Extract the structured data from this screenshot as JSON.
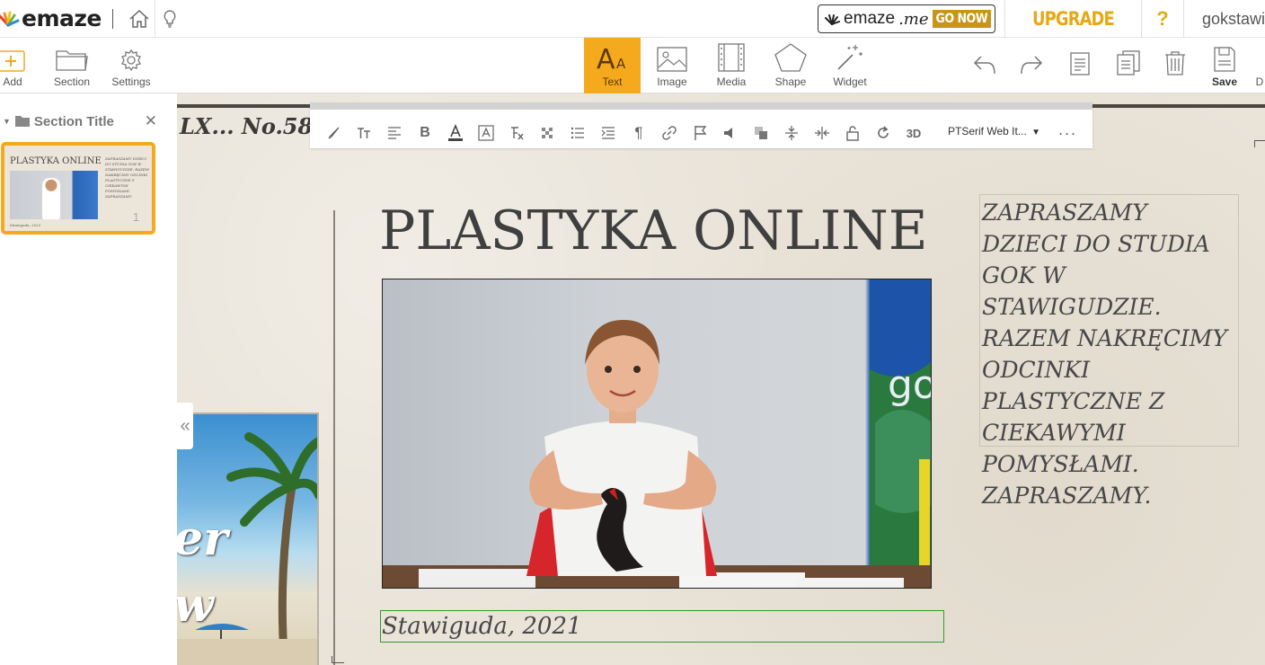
{
  "topbar": {
    "logo": "emaze",
    "emazeme": {
      "brand": "emaze",
      "suffix": ".me",
      "cta": "GO NOW"
    },
    "upgrade": "UPGRADE",
    "help": "?",
    "username": "gokstawiguda"
  },
  "toolbar": {
    "left": [
      {
        "label": "Add",
        "icon": "plus-icon"
      },
      {
        "label": "Section",
        "icon": "folder-icon"
      },
      {
        "label": "Settings",
        "icon": "gear-icon"
      }
    ],
    "center": [
      {
        "label": "Text",
        "icon": "text-icon",
        "active": true
      },
      {
        "label": "Image",
        "icon": "image-icon"
      },
      {
        "label": "Media",
        "icon": "film-icon"
      },
      {
        "label": "Shape",
        "icon": "pentagon-icon"
      },
      {
        "label": "Widget",
        "icon": "magic-wand-icon"
      }
    ],
    "right": {
      "save_label": "Save",
      "next_label": "D"
    }
  },
  "sidebar": {
    "section_title": "Section Title",
    "thumbnail": {
      "title": "PLASTYKA ONLINE",
      "text": "ZAPRASZAMY DZIECI DO STUDIA GOK W STAWIGUDZIE. RAZEM NAKRĘCIMY ODCINKI PLASTYCZNE Z CIEKAWYMI POMYSŁAMI. ZAPRASZAMY.",
      "footer": "Stawiguda, 2021",
      "number": "1"
    }
  },
  "canvas": {
    "issue": "LX... No.58,",
    "poster_text": "er\nw",
    "format_toolbar": {
      "font": "PTSerif Web It...",
      "bold": "B",
      "three_d": "3D",
      "more": "..."
    },
    "slide": {
      "title": "PLASTYKA ONLINE",
      "body": "ZAPRASZAMY DZIECI DO STUDIA GOK W STAWIGUDZIE. RAZEM NAKRĘCIMY ODCINKI PLASTYCZNE Z CIEKAWYMI POMYSŁAMI. ZAPRASZAMY.",
      "caption": "Stawiguda, 2021",
      "photo_sign_text": "go"
    }
  }
}
